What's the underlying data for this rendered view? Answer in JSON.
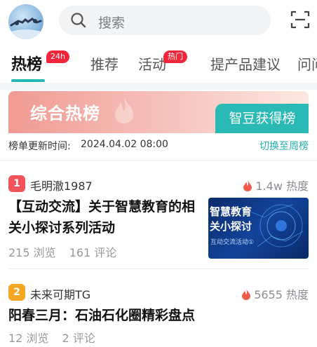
{
  "header": {
    "search_placeholder": "搜索"
  },
  "tabs": [
    {
      "label": "热榜",
      "badge": "24h",
      "active": true
    },
    {
      "label": "推荐"
    },
    {
      "label": "活动",
      "badge": "热门"
    },
    {
      "label": "提产品建议"
    },
    {
      "label": "问问"
    }
  ],
  "banner": {
    "title": "综合热榜",
    "button": "智豆获得榜"
  },
  "update": {
    "label": "榜单更新时间:",
    "time": "2024.04.02 08:00",
    "switch": "切换至周榜"
  },
  "items": [
    {
      "rank": "1",
      "author": "毛明澈1987",
      "heat": "1.4w 热度",
      "title_line1": "【互动交流】关于智慧教育的相",
      "title_line2": "关小探讨系列活动",
      "views": "215 浏览",
      "comments": "161 评论",
      "thumb_title_line1": "智慧教育",
      "thumb_title_line2": "关小探讨",
      "thumb_sub": "互动交流活动①"
    },
    {
      "rank": "2",
      "author": "未来可期TG",
      "heat": "5655 热度",
      "title": "阳春三月：石油石化圈精彩盘点",
      "views": "12 浏览",
      "comments": "2 评论"
    }
  ],
  "colors": {
    "accent": "#25b7b4",
    "badge_red": "#f2263a",
    "rank1": "#f0545a",
    "rank2": "#f5a623",
    "flame": "#f25a4c"
  }
}
